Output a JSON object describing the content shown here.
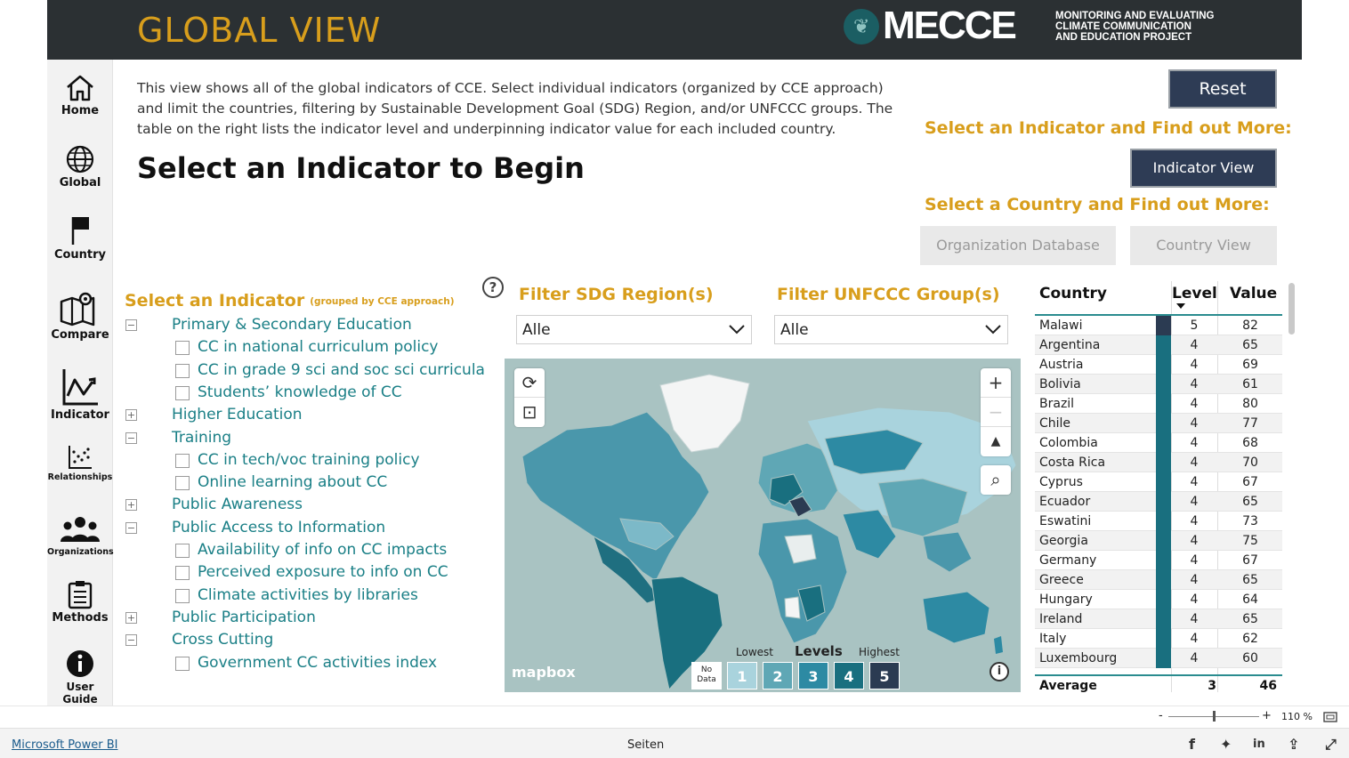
{
  "header": {
    "title": "GLOBAL VIEW",
    "logo_word": "MECCE",
    "logo_sub_1": "MONITORING AND EVALUATING",
    "logo_sub_2": "CLIMATE COMMUNICATION",
    "logo_sub_3": "AND EDUCATION PROJECT"
  },
  "nav": {
    "home": "Home",
    "global": "Global",
    "country": "Country",
    "compare": "Compare",
    "indicator": "Indicator",
    "relationships": "Relationships",
    "organizations": "Organizations",
    "methods": "Methods",
    "user_guide": "User Guide"
  },
  "intro": {
    "text": "This view shows all of the global indicators of CCE. Select individual indicators (organized by CCE approach) and limit the countries, filtering by Sustainable Development Goal (SDG) Region, and/or UNFCCC groups. The table on the right lists the indicator level and underpinning indicator value for each included country.",
    "title": "Select an Indicator to Begin"
  },
  "right_panel": {
    "reset": "Reset",
    "indicator_head": "Select an Indicator and Find out More:",
    "indicator_view": "Indicator View",
    "country_head": "Select a Country and Find out More:",
    "org_db": "Organization Database",
    "country_view": "Country View"
  },
  "indicator_panel": {
    "title": "Select an Indicator",
    "subtitle": "(grouped by CCE approach)",
    "categories": [
      {
        "label": "Primary & Secondary Education",
        "toggle": "−",
        "items": [
          "CC in national curriculum policy",
          "CC in grade 9 sci and soc sci curricula",
          "Students’ knowledge of CC"
        ]
      },
      {
        "label": "Higher Education",
        "toggle": "+",
        "items": []
      },
      {
        "label": "Training",
        "toggle": "−",
        "items": [
          "CC in tech/voc training policy",
          "Online learning about CC"
        ]
      },
      {
        "label": "Public Awareness",
        "toggle": "+",
        "items": []
      },
      {
        "label": "Public Access to Information",
        "toggle": "−",
        "items": [
          "Availability of info on CC impacts",
          "Perceived exposure to info on CC",
          "Climate activities by libraries"
        ]
      },
      {
        "label": "Public Participation",
        "toggle": "+",
        "items": []
      },
      {
        "label": "Cross Cutting",
        "toggle": "−",
        "items": [
          "Government CC activities index"
        ]
      }
    ]
  },
  "filters": {
    "help": "?",
    "sdg_label": "Filter SDG Region(s)",
    "sdg_value": "Alle",
    "unfccc_label": "Filter UNFCCC Group(s)",
    "unfccc_value": "Alle"
  },
  "map": {
    "zoom_in": "+",
    "zoom_out": "−",
    "compass": "▲",
    "attribution": "mapbox",
    "info": "i",
    "legend": {
      "lowest": "Lowest",
      "title": "Levels",
      "highest": "Highest",
      "no_data": "No Data",
      "levels": [
        {
          "label": "1",
          "color": "#a9d3dd"
        },
        {
          "label": "2",
          "color": "#5fa7b5"
        },
        {
          "label": "3",
          "color": "#2d8aa3"
        },
        {
          "label": "4",
          "color": "#196f7f"
        },
        {
          "label": "5",
          "color": "#2b3b52"
        }
      ]
    }
  },
  "table": {
    "headers": {
      "country": "Country",
      "level": "Level",
      "value": "Value"
    },
    "rows": [
      {
        "country": "Malawi",
        "level": "5",
        "value": "82"
      },
      {
        "country": "Argentina",
        "level": "4",
        "value": "65"
      },
      {
        "country": "Austria",
        "level": "4",
        "value": "69"
      },
      {
        "country": "Bolivia",
        "level": "4",
        "value": "61"
      },
      {
        "country": "Brazil",
        "level": "4",
        "value": "80"
      },
      {
        "country": "Chile",
        "level": "4",
        "value": "77"
      },
      {
        "country": "Colombia",
        "level": "4",
        "value": "68"
      },
      {
        "country": "Costa Rica",
        "level": "4",
        "value": "70"
      },
      {
        "country": "Cyprus",
        "level": "4",
        "value": "67"
      },
      {
        "country": "Ecuador",
        "level": "4",
        "value": "65"
      },
      {
        "country": "Eswatini",
        "level": "4",
        "value": "73"
      },
      {
        "country": "Georgia",
        "level": "4",
        "value": "75"
      },
      {
        "country": "Germany",
        "level": "4",
        "value": "67"
      },
      {
        "country": "Greece",
        "level": "4",
        "value": "65"
      },
      {
        "country": "Hungary",
        "level": "4",
        "value": "64"
      },
      {
        "country": "Ireland",
        "level": "4",
        "value": "65"
      },
      {
        "country": "Italy",
        "level": "4",
        "value": "62"
      },
      {
        "country": "Luxembourg",
        "level": "4",
        "value": "60"
      }
    ],
    "average": {
      "label": "Average",
      "level": "3",
      "value": "46"
    }
  },
  "zoom": {
    "minus": "-",
    "plus": "+",
    "percent": "110 %"
  },
  "footer": {
    "link": "Microsoft Power BI",
    "pages": "Seiten"
  }
}
